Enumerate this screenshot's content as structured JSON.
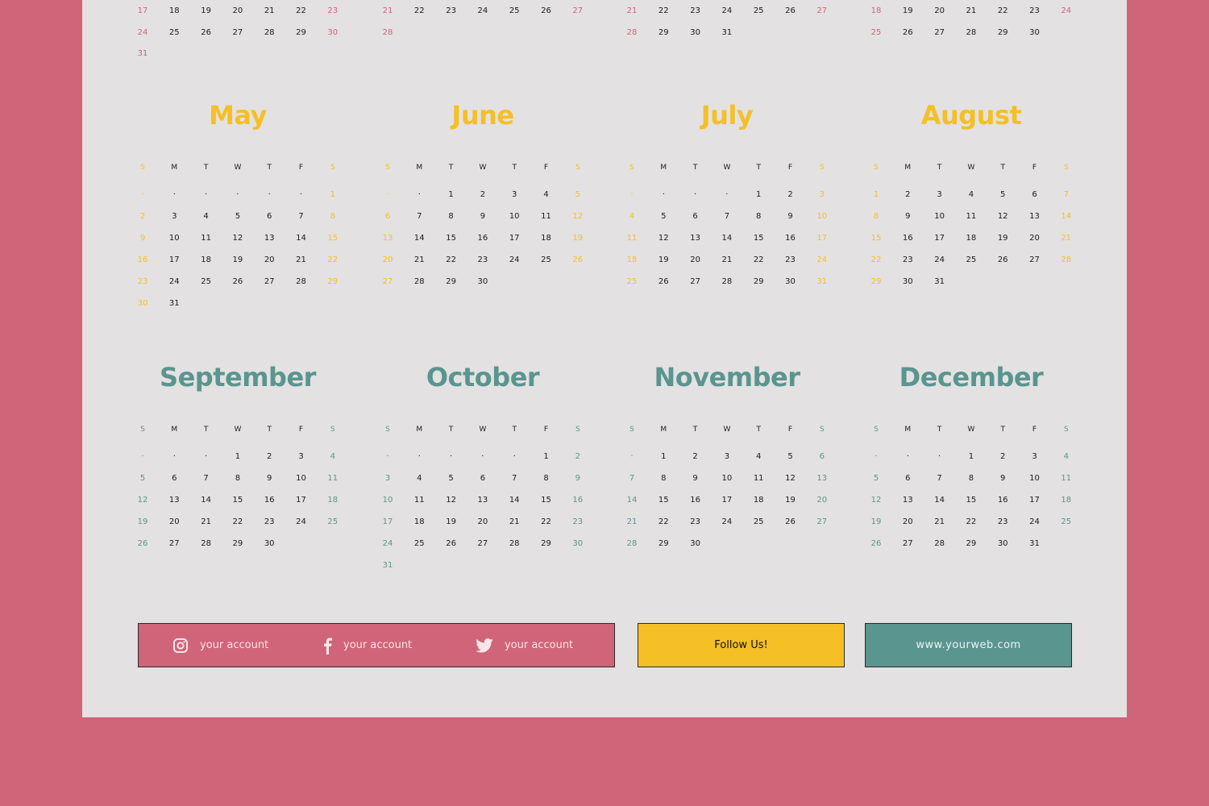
{
  "colors": {
    "background": "#d06478",
    "panel": "#e3e1e1",
    "pink": "#d06478",
    "yellow": "#f4c026",
    "teal": "#5a958f"
  },
  "weekdays": [
    "S",
    "M",
    "T",
    "W",
    "T",
    "F",
    "S"
  ],
  "partial_months": [
    {
      "accent": "#d06478",
      "weeks": [
        [
          17,
          18,
          19,
          20,
          21,
          22,
          23
        ],
        [
          24,
          25,
          26,
          27,
          28,
          29,
          30
        ],
        [
          31
        ]
      ]
    },
    {
      "accent": "#d06478",
      "weeks": [
        [
          21,
          22,
          23,
          24,
          25,
          26,
          27
        ],
        [
          28
        ]
      ]
    },
    {
      "accent": "#d06478",
      "weeks": [
        [
          21,
          22,
          23,
          24,
          25,
          26,
          27
        ],
        [
          28,
          29,
          30,
          31
        ]
      ]
    },
    {
      "accent": "#d06478",
      "weeks": [
        [
          18,
          19,
          20,
          21,
          22,
          23,
          24
        ],
        [
          25,
          26,
          27,
          28,
          29,
          30
        ]
      ]
    }
  ],
  "months": [
    {
      "name": "May",
      "accent": "#f4c026",
      "weeks": [
        [
          "·",
          "·",
          "·",
          "·",
          "·",
          "·",
          1
        ],
        [
          2,
          3,
          4,
          5,
          6,
          7,
          8
        ],
        [
          9,
          10,
          11,
          12,
          13,
          14,
          15
        ],
        [
          16,
          17,
          18,
          19,
          20,
          21,
          22
        ],
        [
          23,
          24,
          25,
          26,
          27,
          28,
          29
        ],
        [
          30,
          31
        ]
      ]
    },
    {
      "name": "June",
      "accent": "#f4c026",
      "weeks": [
        [
          "·",
          "·",
          1,
          2,
          3,
          4,
          5
        ],
        [
          6,
          7,
          8,
          9,
          10,
          11,
          12
        ],
        [
          13,
          14,
          15,
          16,
          17,
          18,
          19
        ],
        [
          20,
          21,
          22,
          23,
          24,
          25,
          26
        ],
        [
          27,
          28,
          29,
          30
        ]
      ]
    },
    {
      "name": "July",
      "accent": "#f4c026",
      "weeks": [
        [
          "·",
          "·",
          "·",
          "·",
          1,
          2,
          3
        ],
        [
          4,
          5,
          6,
          7,
          8,
          9,
          10
        ],
        [
          11,
          12,
          13,
          14,
          15,
          16,
          17
        ],
        [
          18,
          19,
          20,
          21,
          22,
          23,
          24
        ],
        [
          25,
          26,
          27,
          28,
          29,
          30,
          31
        ]
      ]
    },
    {
      "name": "August",
      "accent": "#f4c026",
      "weeks": [
        [
          1,
          2,
          3,
          4,
          5,
          6,
          7
        ],
        [
          8,
          9,
          10,
          11,
          12,
          13,
          14
        ],
        [
          15,
          16,
          17,
          18,
          19,
          20,
          21
        ],
        [
          22,
          23,
          24,
          25,
          26,
          27,
          28
        ],
        [
          29,
          30,
          31
        ]
      ]
    },
    {
      "name": "September",
      "accent": "#5a958f",
      "weeks": [
        [
          "·",
          "·",
          "·",
          1,
          2,
          3,
          4
        ],
        [
          5,
          6,
          7,
          8,
          9,
          10,
          11
        ],
        [
          12,
          13,
          14,
          15,
          16,
          17,
          18
        ],
        [
          19,
          20,
          21,
          22,
          23,
          24,
          25
        ],
        [
          26,
          27,
          28,
          29,
          30
        ]
      ]
    },
    {
      "name": "October",
      "accent": "#5a958f",
      "weeks": [
        [
          "·",
          "·",
          "·",
          "·",
          "·",
          1,
          2
        ],
        [
          3,
          4,
          5,
          6,
          7,
          8,
          9
        ],
        [
          10,
          11,
          12,
          13,
          14,
          15,
          16
        ],
        [
          17,
          18,
          19,
          20,
          21,
          22,
          23
        ],
        [
          24,
          25,
          26,
          27,
          28,
          29,
          30
        ],
        [
          31
        ]
      ]
    },
    {
      "name": "November",
      "accent": "#5a958f",
      "weeks": [
        [
          "·",
          1,
          2,
          3,
          4,
          5,
          6
        ],
        [
          7,
          8,
          9,
          10,
          11,
          12,
          13
        ],
        [
          14,
          15,
          16,
          17,
          18,
          19,
          20
        ],
        [
          21,
          22,
          23,
          24,
          25,
          26,
          27
        ],
        [
          28,
          29,
          30
        ]
      ]
    },
    {
      "name": "December",
      "accent": "#5a958f",
      "weeks": [
        [
          "·",
          "·",
          "·",
          1,
          2,
          3,
          4
        ],
        [
          5,
          6,
          7,
          8,
          9,
          10,
          11
        ],
        [
          12,
          13,
          14,
          15,
          16,
          17,
          18
        ],
        [
          19,
          20,
          21,
          22,
          23,
          24,
          25
        ],
        [
          26,
          27,
          28,
          29,
          30,
          31
        ]
      ]
    }
  ],
  "footer": {
    "social": [
      {
        "icon": "instagram-icon",
        "label": "your account"
      },
      {
        "icon": "facebook-icon",
        "label": "your account"
      },
      {
        "icon": "twitter-icon",
        "label": "your account"
      }
    ],
    "follow_label": "Follow Us!",
    "website": "www.yourweb.com"
  }
}
